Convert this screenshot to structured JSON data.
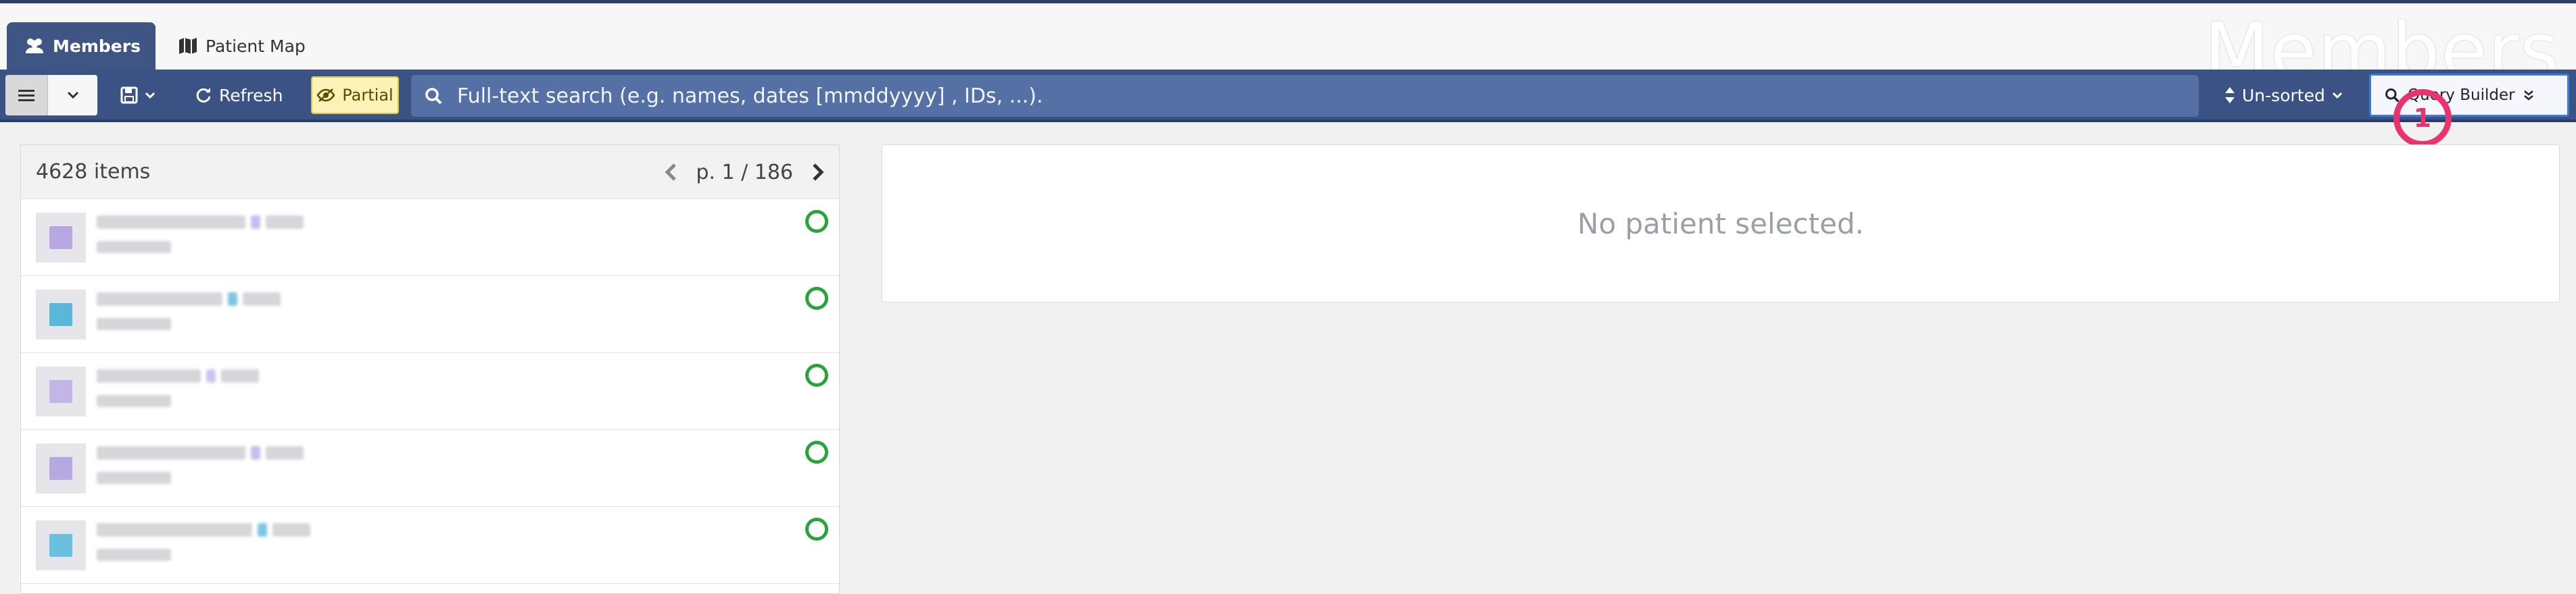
{
  "watermark": "Members",
  "tabs": [
    {
      "label": "Members",
      "icon": "users-icon",
      "active": true
    },
    {
      "label": "Patient Map",
      "icon": "map-icon",
      "active": false
    }
  ],
  "toolbar": {
    "refresh_label": "Refresh",
    "partial_label": "Partial",
    "search_placeholder": "Full-text search (e.g. names, dates [mmddyyyy] , IDs, ...).",
    "sort_label": "Un-sorted",
    "query_builder_label": "Query Builder"
  },
  "step_marker": "1",
  "list": {
    "count_label": "4628 items",
    "page_label": "p. 1 / 186",
    "items": [
      {
        "accent": "#b7a6e0",
        "status": "active"
      },
      {
        "accent": "#5ab7d9",
        "status": "active"
      },
      {
        "accent": "#c3b5e6",
        "status": "active"
      },
      {
        "accent": "#b8a8e2",
        "status": "active"
      },
      {
        "accent": "#6ac0df",
        "status": "active"
      }
    ]
  },
  "detail": {
    "empty_message": "No patient selected."
  },
  "colors": {
    "toolbar": "#3b5285",
    "tab_active": "#3f5685",
    "status_green": "#2aa43a",
    "marker": "#e8336f"
  }
}
